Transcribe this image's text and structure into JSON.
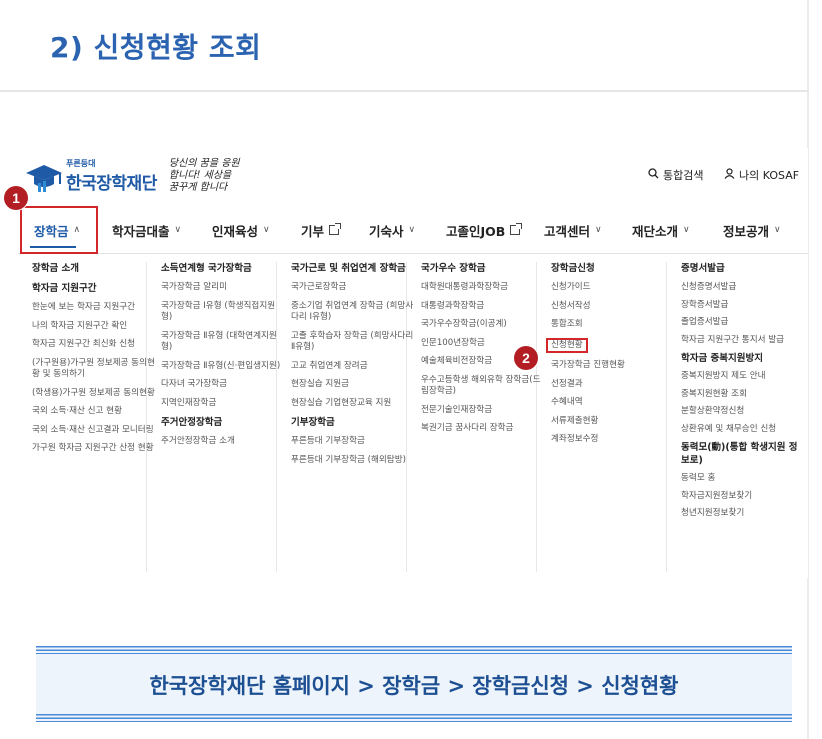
{
  "page": {
    "title": "2) 신청현황 조회",
    "breadcrumb": "한국장학재단 홈페이지 > 장학금 > 장학금신청 > 신청현황"
  },
  "header": {
    "logo_sub": "푸른등대",
    "logo_main": "한국장학재단",
    "slogan": "당신의 꿈을 응원합니다! 세상을 꿈꾸게 합니다",
    "search_label": "통합검색",
    "mykosaf_label": "나의 KOSAF"
  },
  "badges": [
    "1",
    "2"
  ],
  "gnb": [
    {
      "label": "장학금",
      "chevron": "^",
      "active": true
    },
    {
      "label": "학자금대출",
      "chevron": "v"
    },
    {
      "label": "인재육성",
      "chevron": "v"
    },
    {
      "label": "기부",
      "external": true
    },
    {
      "label": "기숙사",
      "chevron": "v"
    },
    {
      "label": "고졸인JOB",
      "external": true
    },
    {
      "label": "고객센터",
      "chevron": "v"
    },
    {
      "label": "재단소개",
      "chevron": "v"
    },
    {
      "label": "정보공개",
      "chevron": "v"
    }
  ],
  "mega": {
    "col1": {
      "title": "장학금 소개",
      "sub": "학자금 지원구간",
      "links": [
        "한눈에 보는 학자금 지원구간",
        "나의 학자금 지원구간 확인",
        "학자금 지원구간 최신화 신청",
        "(가구원용)가구원 정보제공 동의현황 및 동의하기",
        "(학생용)가구원 정보제공 동의현황",
        "국외 소득·재산 신고 현황",
        "국외 소득·재산 신고결과 모니터링",
        "가구원 학자금 지원구간 산정 현황"
      ]
    },
    "col2": {
      "title": "소득연계형 국가장학금",
      "links": [
        "국가장학금 알리미",
        "국가장학금 Ⅰ유형 (학생직접지원형)",
        "국가장학금 Ⅱ유형 (대학연계지원형)",
        "국가장학금 Ⅱ유형(신·편입생지원)",
        "다자녀 국가장학금",
        "지역인재장학금"
      ],
      "sub": "주거안정장학금",
      "links2": [
        "주거안정장학금 소개"
      ]
    },
    "col3": {
      "title": "국가근로 및 취업연계 장학금",
      "links": [
        "국가근로장학금",
        "중소기업 취업연계 장학금 (희망사다리 Ⅰ유형)",
        "고졸 후학습자 장학금 (희망사다리 Ⅱ유형)",
        "고교 취업연계 장려금",
        "현장실습 지원금",
        "현장실습 기업현장교육 지원"
      ],
      "sub": "기부장학금",
      "links2": [
        "푸른등대 기부장학금",
        "푸른등대 기부장학금 (해외탐방)"
      ]
    },
    "col4": {
      "title": "국가우수 장학금",
      "links": [
        "대학원대통령과학장학금",
        "대통령과학장학금",
        "국가우수장학금(이공계)",
        "인문100년장학금",
        "예술체육비전장학금",
        "우수고등학생 해외유학 장학금(드림장학금)",
        "전문기술인재장학금",
        "복권기금 꿈사다리 장학금"
      ]
    },
    "col5": {
      "title": "장학금신청",
      "links": [
        "신청가이드",
        "신청서작성",
        "통합조회",
        "신청현황",
        "국가장학금 진행현황",
        "선정결과",
        "수혜내역",
        "서류제출현황",
        "계좌정보수정"
      ]
    },
    "col6": {
      "title": "증명서발급",
      "links": [
        "신청증명서발급",
        "장학증서발급",
        "졸업증서발급",
        "학자금 지원구간 통지서 발급"
      ],
      "sub": "학자금 중복지원방지",
      "links2": [
        "중복지원방지 제도 안내",
        "중복지원현황 조회",
        "분할상환약정신청",
        "상환유예 및 채무승인 신청"
      ],
      "sub2": "동력모(動)(통합 학생지원 정보로)",
      "links3": [
        "동력모 홈",
        "학자금지원정보찾기",
        "청년지원정보찾기"
      ]
    }
  },
  "colors": {
    "title_blue": "#2b63b0",
    "brand_blue": "#1f5aa6",
    "highlight_red": "#d3272c",
    "badge_red": "#b21e23",
    "breadcrumb_bg": "#eef4fb"
  }
}
